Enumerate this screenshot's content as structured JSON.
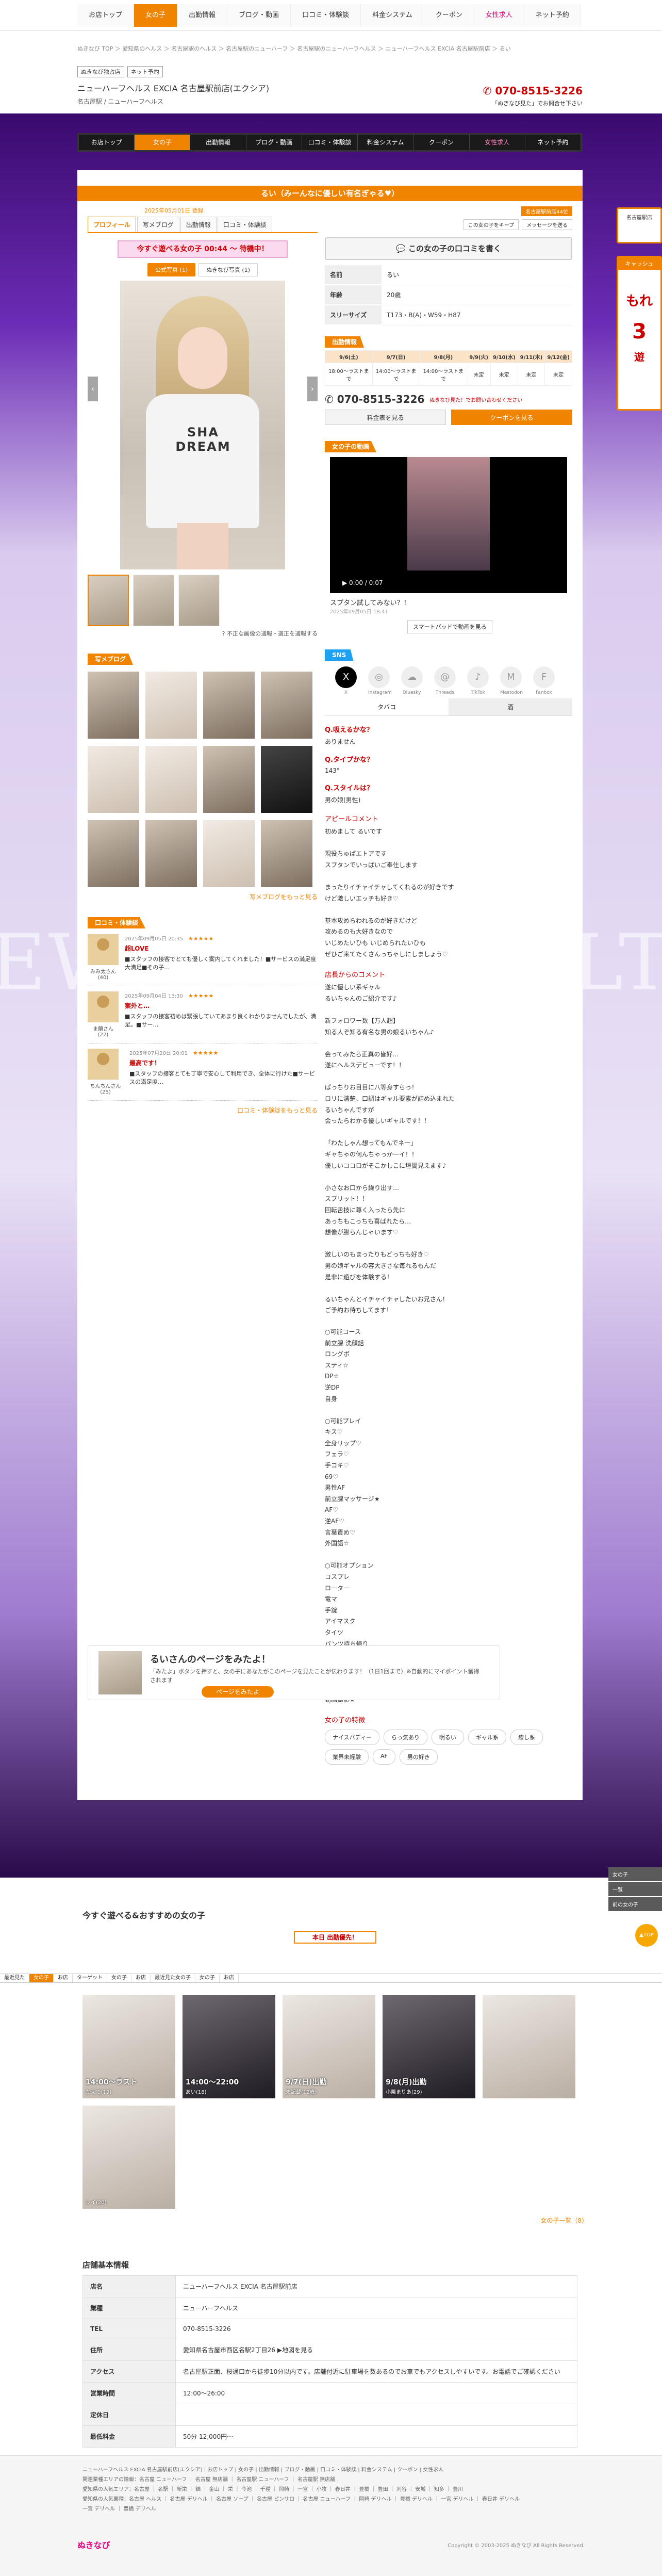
{
  "topnav": [
    "お店トップ",
    "女の子",
    "出勤情報",
    "ブログ・動画",
    "口コミ・体験談",
    "料金システム",
    "クーポン",
    "女性求人",
    "ネット予約"
  ],
  "breadcrumb": "ぬきなび TOP ＞ 愛知県のヘルス ＞ 名古屋駅のヘルス ＞ 名古屋駅のニューハーフ ＞ 名古屋駅のニューハーフヘルス ＞ ニューハーフヘルス EXCIA 名古屋駅前店 ＞ るい",
  "header": {
    "badges": [
      "ぬきなび独占店",
      "ネット予約"
    ],
    "shop_name": "ニューハーフヘルス EXCIA 名古屋駅前店(エクシア)",
    "area": "名古屋駅 / ニューハーフヘルス",
    "tel": "070-8515-3226",
    "tel_sub": "「ぬきなび見た」でお問合せ下さい"
  },
  "side": {
    "badge1": "名古屋駅店",
    "badge2_banner": "キャッシュ",
    "badge2_text": "もれ",
    "badge2_amount": "3",
    "badge2_sub": "遊"
  },
  "hero_text_left": "EW",
  "hero_text_right": "LT",
  "main_title": "るい（みーんなに優しい有名ぎゃる♥）",
  "since": "2025年05月01日 登録",
  "rank_badge": "名古屋駅前店44位",
  "fav_buttons": [
    "この女の子をキープ",
    "メッセージを送る"
  ],
  "profile_tabs": [
    "プロフィール",
    "写メブログ",
    "出勤情報",
    "口コミ・体験談"
  ],
  "now_box": "今すぐ遊べる女の子 00:44 〜 待機中！",
  "photo_toggle": [
    "公式写真 (1)",
    "ぬきなび写真 (1)"
  ],
  "photo_shirt_text": "SHA DREAM",
  "report_link": "不正な画像の通報・適正を通報する",
  "kuchikomi_btn": "この女の子の口コミを書く",
  "profile": [
    {
      "k": "名前",
      "v": "るい"
    },
    {
      "k": "年齢",
      "v": "20歳"
    },
    {
      "k": "スリーサイズ",
      "v": "T173・B(A)・W59・H87"
    }
  ],
  "schedule_title": "出勤情報",
  "schedule": {
    "days": [
      "9/6(土)",
      "9/7(日)",
      "9/8(月)",
      "9/9(火)",
      "9/10(水)",
      "9/11(木)",
      "9/12(金)"
    ],
    "times": [
      "18:00〜ラストまで",
      "14:00〜ラストまで",
      "14:00〜ラストまで",
      "未定",
      "未定",
      "未定",
      "未定"
    ]
  },
  "call": {
    "tel": "070-8515-3226",
    "note": "ぬきなび見た！でお問い合わせください"
  },
  "buttons": [
    "料金表を見る",
    "クーポンを見る"
  ],
  "video_title": "女の子の動画",
  "video_time": "0:00 / 0:07",
  "video_caption": "スプタン試してみない？！",
  "video_date": "2025年09月05日 18:41",
  "video_btn": "スマートパッドで動画を見る",
  "sns_title": "SNS",
  "sns": [
    "X",
    "Instagram",
    "Bluesky",
    "Threads",
    "TikTok",
    "Mastodon",
    "Fanbox"
  ],
  "qa_tabs": [
    "タバコ",
    "酒"
  ],
  "qa": [
    {
      "q": "Q.吸えるかな？",
      "a": "ありません"
    },
    {
      "q": "Q.タイプかな？",
      "a": "143°"
    },
    {
      "q": "Q.スタイルは？",
      "a": "男の娘(男性)"
    }
  ],
  "appeal_title": "アピールコメント",
  "appeal_lines": "初めまして るいです\n\n現役ちゅぱエトアです\nスプタンでいっぱいご奉仕します\n\nまったりイチャイチャしてくれるのが好きです\nけど激しいエッチも好き♡\n\n基本攻めらわれるのが好きだけど\n攻めるのも大好きなので\nいじめたいひも いじめられたいひも\nぜひご来てたくさんっちゃしにしましょう♡",
  "staff_title": "店長からのコメント",
  "staff_lines": "遂に優しい系ギャル\nるいちゃんのご紹介です♪\n\n新フォロワー数【万人超】\n知る人ぞ知る有名な男の娘るいちゃん♪\n\n会ってみたら正真の皆好…\n遂にヘルスデビューです！！\n\nぱっちりお目目に八等身すらっ！\nロリに清楚、口調はギャル要素が詰め込まれた\nるいちゃんですが\n会ったらわかる優しいギャルです！！\n\n「わたしゃん想ってもんでネー」\nギャちゃの何んちゃっかーイ！！\n優しいココロがそこかしこに垣間見えます♪\n\n小さなお口から繰り出す…\nスプリット！！\n回転舌技に尊く入ったら先に\nあっちもこっちも喜ばれたら…\n想像が膨らんじゃいます♡\n\n激しいのもまったりもどっちも好き♡\n男の娘ギャルの容大きさな毎れるもんだ\n是非に遊びを体験する！\n\nるいちゃんとイチャイチャしたいお兄さん！\nご予約お待ちしてます！",
  "options_lines": "○可能コース\n前立腺 洗顔話\nロングボ\nスティ☆\nDP☆\n逆DP\n自身\n\n○可能プレイ\nキス♡\n全身リップ♡\nフェラ♡\n手コキ♡\n69♡\n男性AF\n前立腺マッサージ★\nAF♡\n逆AF♡\n言葉責め♡\n外国語☆\n\n○可能オプション\nコスプレ\nローター\n電マ\n手錠\nアイマスク\nタイツ\nパンツ持ち帰り\nオナニー鑑賞\n顔射\n聖水★\n写真撮影(3枚)★\n動画撮影★",
  "girl_tags_title": "女の子の特徴",
  "girl_tags": [
    "ナイスバディー",
    "らっ気あり",
    "明るい",
    "ギャル系",
    "癒し系",
    "業界未経験",
    "AF",
    "男の好き"
  ],
  "blog_title": "写メブログ",
  "blog_more": "写メブログをもっと見る",
  "review_title": "口コミ・体験談",
  "reviews": [
    {
      "name": "みみ太さん(40)",
      "date": "2025年09月05日 20:35",
      "title": "超LOVE",
      "text": "■スタッフの接客でとても優しく案内してくれました！■サービスの満足度大満足■その子…"
    },
    {
      "name": "ま蘭さん(22)",
      "date": "2025年09月04日 13:30",
      "title": "案外と…",
      "text": "■スタッフの接客初めは緊張していてあまり良くわかりませんでしたが、満足。■サー…"
    },
    {
      "name": "ちんちんさん(25)",
      "date": "2025年07月20日 20:01",
      "title": "最高です！",
      "text": "■スタッフの接客とても丁寧で安心して利用でき、全体に行けた■サービスの満足度…"
    }
  ],
  "review_more": "口コミ・体験談をもっと見る",
  "pagebox": {
    "title": "るいさんのページをみたよ！",
    "desc": "「みたよ」ボタンを押すと、女の子にあなたがこのページを見たことが伝わります！（1日1回まで）※自動的にマイポイント獲得されます",
    "btn": "ページをみたよ"
  },
  "today_title": "今すぐ遊べる&おすすめの女の子",
  "today_badge": "本日 出勤優先！",
  "girls": [
    {
      "time": "14:00〜ラスト",
      "name": "かえで(19)"
    },
    {
      "time": "14:00〜22:00",
      "name": "あい(18)"
    },
    {
      "time": "9/7(日)出勤",
      "name": "未記載(12歳)"
    },
    {
      "time": "9/8(月)出勤",
      "name": "小栗まりあ(29)"
    },
    {
      "time": "",
      "name": ""
    },
    {
      "time": "",
      "name": "レイ(20)"
    }
  ],
  "girls_more": "女の子一覧（8）",
  "sticky": [
    "最近見た",
    "女の子",
    "お店",
    "ターゲット",
    "女の子",
    "お店",
    "最近見た女の子",
    "女の子",
    "お店"
  ],
  "side_links": [
    "女の子",
    "一覧",
    "前の女の子"
  ],
  "shop_info_title": "店舗基本情報",
  "shop_info": [
    {
      "k": "店名",
      "v": "ニューハーフヘルス EXCIA 名古屋駅前店"
    },
    {
      "k": "業種",
      "v": "ニューハーフヘルス"
    },
    {
      "k": "TEL",
      "v": "070-8515-3226"
    },
    {
      "k": "住所",
      "v": "愛知県名古屋市西区名駅2丁目26 ▶地図を見る"
    },
    {
      "k": "アクセス",
      "v": "名古屋駅正面、桜通口から徒歩10分以内です。店舗付近に駐車場を数あるのでお車でもアクセスしやすいです。お電話でご確認ください"
    },
    {
      "k": "営業時間",
      "v": "12:00〜26:00"
    },
    {
      "k": "定休日",
      "v": ""
    },
    {
      "k": "最低料金",
      "v": "50分 12,000円〜"
    }
  ],
  "footer": {
    "links": "ニューハーフヘルス EXCIA 名古屋駅前店(エクシア) | お店トップ | 女の子 | 出勤情報 | ブログ・動画 | 口コミ・体験談 | 料金システム | クーポン | 女性求人\n関連業種エリアの情報：名古屋 ニューハーフ ｜ 名古屋 無店舗 ｜ 名古屋駅 ニューハーフ ｜ 名古屋駅 無店舗\n愛知県の人気エリア：名古屋 ｜ 名駅 ｜ 新栄 ｜ 錦 ｜ 金山 ｜ 栄 ｜ 今池 ｜ 千種 ｜ 岡崎 ｜ 一宮 ｜ 小牧 ｜ 春日井 ｜ 豊橋 ｜ 豊田 ｜ 刈谷 ｜ 安城 ｜ 知多 ｜ 豊川\n愛知県の人気業種：名古屋 ヘルス ｜ 名古屋 デリヘル ｜ 名古屋 ソープ ｜ 名古屋 ピンサロ ｜ 名古屋 ニューハーフ ｜ 岡崎 デリヘル ｜ 豊橋 デリヘル ｜ 一宮 デリヘル ｜ 春日井 デリヘル\n一宮 デリヘル ｜ 豊橋 デリヘル",
    "logo": "ぬきなび",
    "copy": "Copyright © 2003-2025 ぬきなび All Rights Reserved."
  },
  "colors": {
    "accent": "#f08300",
    "pink": "#e4007f",
    "red": "#cc0000"
  }
}
